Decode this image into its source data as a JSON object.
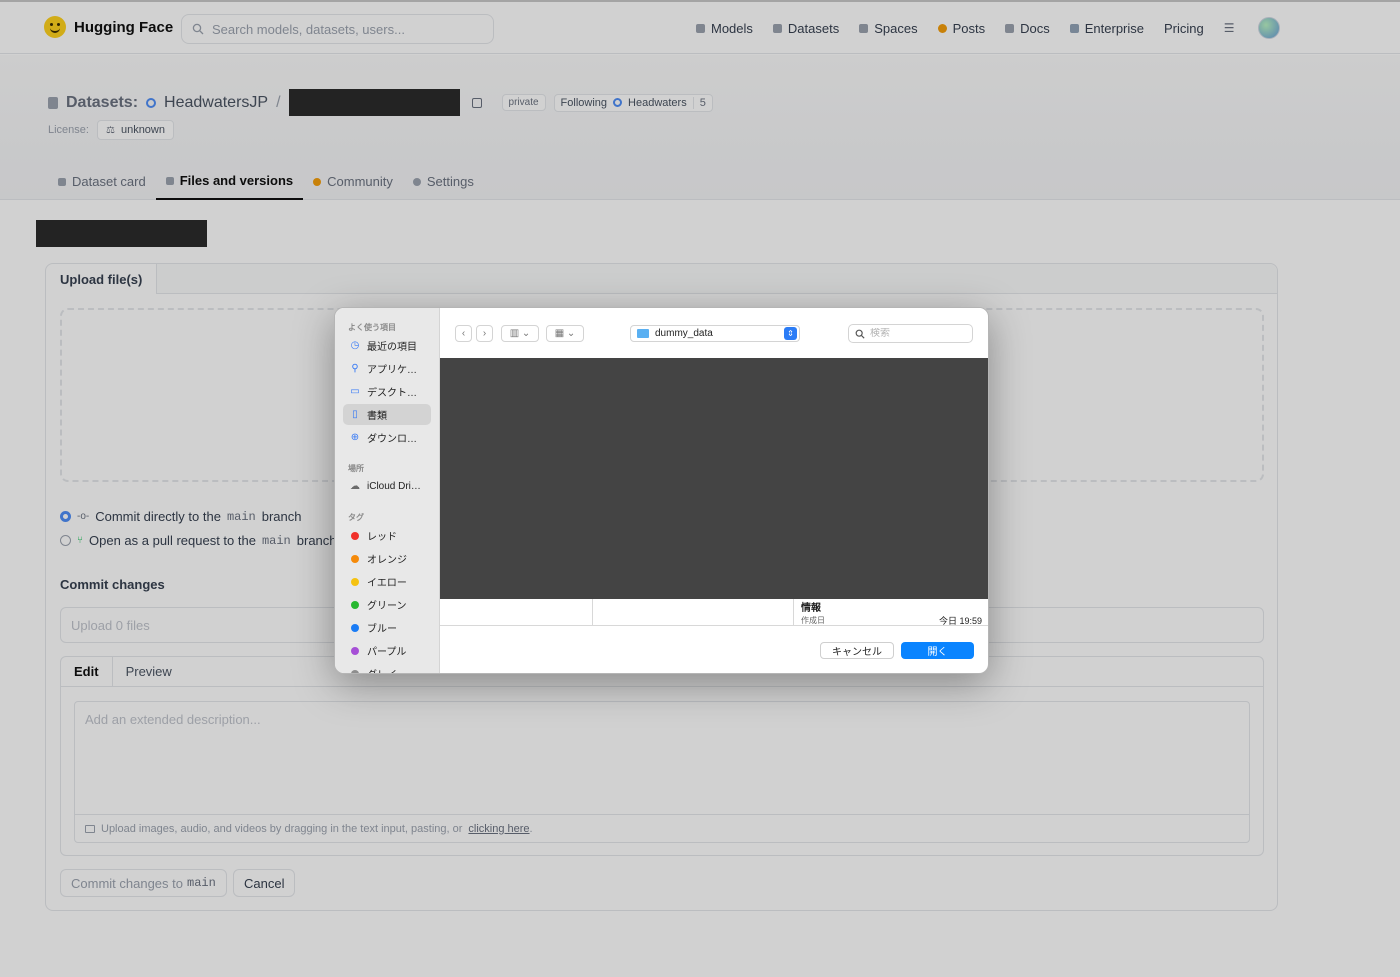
{
  "header": {
    "brand": "Hugging Face",
    "search_placeholder": "Search models, datasets, users...",
    "nav": [
      "Models",
      "Datasets",
      "Spaces",
      "Posts",
      "Docs",
      "Enterprise",
      "Pricing"
    ]
  },
  "repo": {
    "type_label": "Datasets:",
    "org": "HeadwatersJP",
    "separator": "/",
    "visibility": "private",
    "follow_label": "Following",
    "follow_org": "Headwaters",
    "follow_count": "5",
    "license_label": "License:",
    "license_value": "unknown",
    "tabs": [
      "Dataset card",
      "Files and versions",
      "Community",
      "Settings"
    ]
  },
  "upload": {
    "tab_label": "Upload file(s)",
    "radio_commit_prefix": "Commit directly to the",
    "radio_pr_prefix": "Open as a pull request to the",
    "branch": "main",
    "branch_suffix": "branch",
    "commit_title": "Commit changes",
    "summary_placeholder": "Upload 0 files",
    "editor_tab_edit": "Edit",
    "editor_tab_preview": "Preview",
    "description_placeholder": "Add an extended description...",
    "footer_text": "Upload images, audio, and videos by dragging in the text input, pasting, or",
    "footer_link": "clicking here",
    "footer_period": ".",
    "commit_button_prefix": "Commit changes to",
    "cancel_button": "Cancel"
  },
  "dialog": {
    "favorites_heading": "よく使う項目",
    "favorites": [
      "最近の項目",
      "アプリケ…",
      "デスクト…",
      "書類",
      "ダウンロ…"
    ],
    "locations_heading": "場所",
    "locations": [
      "iCloud Dri…"
    ],
    "tags_heading": "タグ",
    "tags": [
      {
        "name": "レッド",
        "color": "#f0302a"
      },
      {
        "name": "オレンジ",
        "color": "#f58a0a"
      },
      {
        "name": "イエロー",
        "color": "#f5c211"
      },
      {
        "name": "グリーン",
        "color": "#27b82f"
      },
      {
        "name": "ブルー",
        "color": "#1a7cf5"
      },
      {
        "name": "パープル",
        "color": "#a64fd6"
      },
      {
        "name": "グレイ",
        "color": "#8e8e8e"
      }
    ],
    "folder": "dummy_data",
    "search_placeholder": "検索",
    "info_title": "情報",
    "info_created_label": "作成日",
    "info_created_value": "今日 19:59",
    "cancel_button": "キャンセル",
    "open_button": "開く"
  }
}
